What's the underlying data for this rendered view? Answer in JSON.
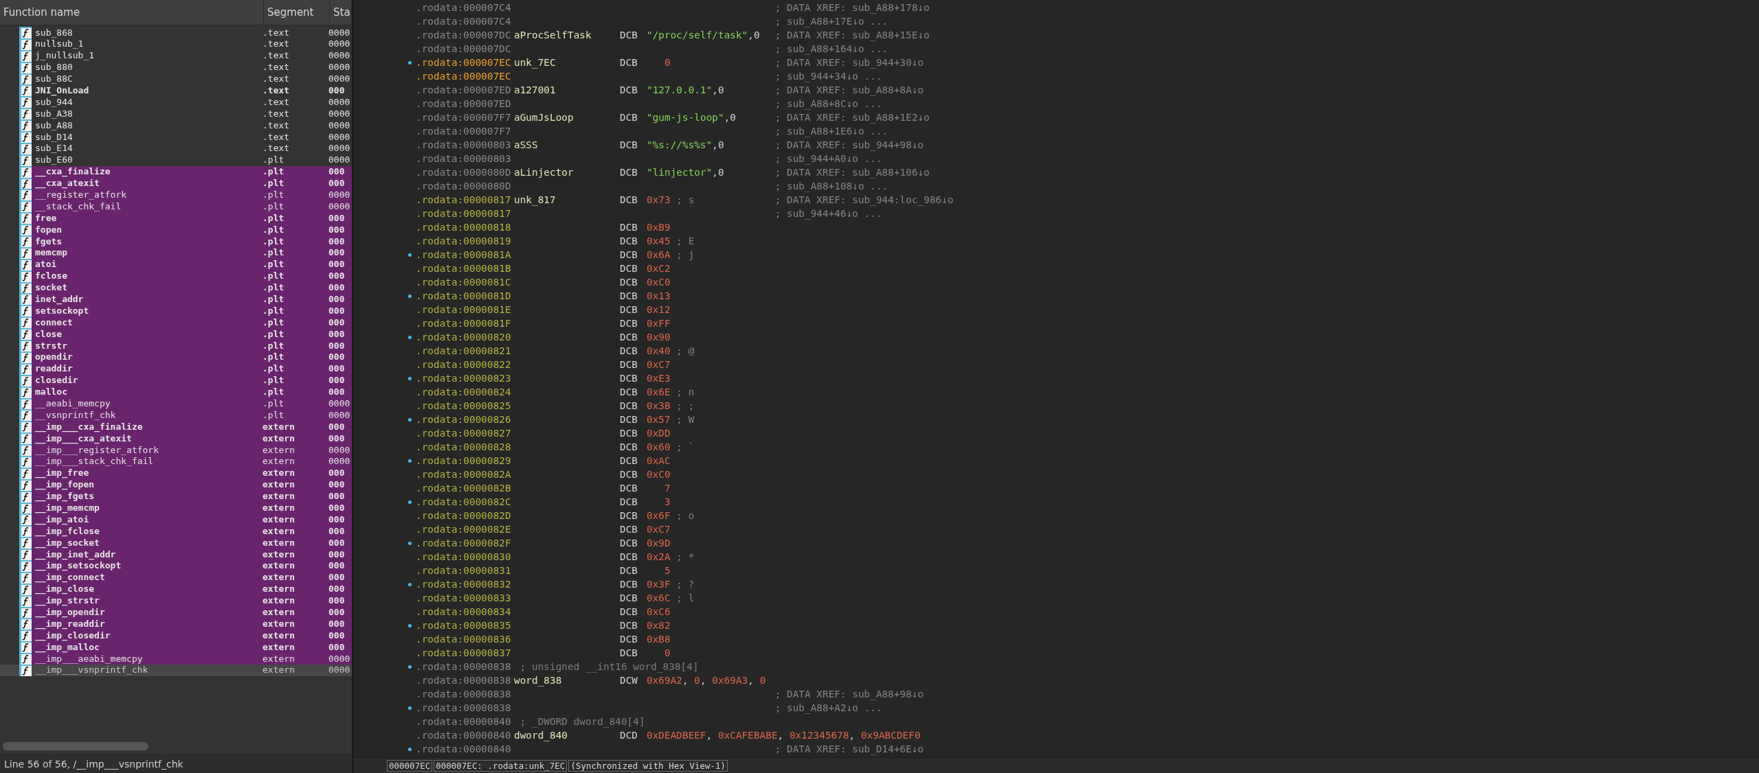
{
  "functions": {
    "columns": [
      "Function name",
      "Segment",
      "Sta"
    ],
    "rows": [
      {
        "name": "sub_868",
        "segment": ".text",
        "start": "0000",
        "bold": false,
        "library": false,
        "selected": false
      },
      {
        "name": "nullsub_1",
        "segment": ".text",
        "start": "0000",
        "bold": false,
        "library": false,
        "selected": false
      },
      {
        "name": "j_nullsub_1",
        "segment": ".text",
        "start": "0000",
        "bold": false,
        "library": false,
        "selected": false
      },
      {
        "name": "sub_880",
        "segment": ".text",
        "start": "0000",
        "bold": false,
        "library": false,
        "selected": false
      },
      {
        "name": "sub_88C",
        "segment": ".text",
        "start": "0000",
        "bold": false,
        "library": false,
        "selected": false
      },
      {
        "name": "JNI_OnLoad",
        "segment": ".text",
        "start": "000",
        "bold": true,
        "library": false,
        "selected": false
      },
      {
        "name": "sub_944",
        "segment": ".text",
        "start": "0000",
        "bold": false,
        "library": false,
        "selected": false
      },
      {
        "name": "sub_A38",
        "segment": ".text",
        "start": "0000",
        "bold": false,
        "library": false,
        "selected": false
      },
      {
        "name": "sub_A88",
        "segment": ".text",
        "start": "0000",
        "bold": false,
        "library": false,
        "selected": false
      },
      {
        "name": "sub_D14",
        "segment": ".text",
        "start": "0000",
        "bold": false,
        "library": false,
        "selected": false
      },
      {
        "name": "sub_E14",
        "segment": ".text",
        "start": "0000",
        "bold": false,
        "library": false,
        "selected": false
      },
      {
        "name": "sub_E60",
        "segment": ".plt",
        "start": "0000",
        "bold": false,
        "library": false,
        "selected": false
      },
      {
        "name": "__cxa_finalize",
        "segment": ".plt",
        "start": "000",
        "bold": true,
        "library": true,
        "selected": false
      },
      {
        "name": "__cxa_atexit",
        "segment": ".plt",
        "start": "000",
        "bold": true,
        "library": true,
        "selected": false
      },
      {
        "name": "__register_atfork",
        "segment": ".plt",
        "start": "0000",
        "bold": false,
        "library": true,
        "selected": false
      },
      {
        "name": "__stack_chk_fail",
        "segment": ".plt",
        "start": "0000",
        "bold": false,
        "library": true,
        "selected": false
      },
      {
        "name": "free",
        "segment": ".plt",
        "start": "000",
        "bold": true,
        "library": true,
        "selected": false
      },
      {
        "name": "fopen",
        "segment": ".plt",
        "start": "000",
        "bold": true,
        "library": true,
        "selected": false
      },
      {
        "name": "fgets",
        "segment": ".plt",
        "start": "000",
        "bold": true,
        "library": true,
        "selected": false
      },
      {
        "name": "memcmp",
        "segment": ".plt",
        "start": "000",
        "bold": true,
        "library": true,
        "selected": false
      },
      {
        "name": "atoi",
        "segment": ".plt",
        "start": "000",
        "bold": true,
        "library": true,
        "selected": false
      },
      {
        "name": "fclose",
        "segment": ".plt",
        "start": "000",
        "bold": true,
        "library": true,
        "selected": false
      },
      {
        "name": "socket",
        "segment": ".plt",
        "start": "000",
        "bold": true,
        "library": true,
        "selected": false
      },
      {
        "name": "inet_addr",
        "segment": ".plt",
        "start": "000",
        "bold": true,
        "library": true,
        "selected": false
      },
      {
        "name": "setsockopt",
        "segment": ".plt",
        "start": "000",
        "bold": true,
        "library": true,
        "selected": false
      },
      {
        "name": "connect",
        "segment": ".plt",
        "start": "000",
        "bold": true,
        "library": true,
        "selected": false
      },
      {
        "name": "close",
        "segment": ".plt",
        "start": "000",
        "bold": true,
        "library": true,
        "selected": false
      },
      {
        "name": "strstr",
        "segment": ".plt",
        "start": "000",
        "bold": true,
        "library": true,
        "selected": false
      },
      {
        "name": "opendir",
        "segment": ".plt",
        "start": "000",
        "bold": true,
        "library": true,
        "selected": false
      },
      {
        "name": "readdir",
        "segment": ".plt",
        "start": "000",
        "bold": true,
        "library": true,
        "selected": false
      },
      {
        "name": "closedir",
        "segment": ".plt",
        "start": "000",
        "bold": true,
        "library": true,
        "selected": false
      },
      {
        "name": "malloc",
        "segment": ".plt",
        "start": "000",
        "bold": true,
        "library": true,
        "selected": false
      },
      {
        "name": "__aeabi_memcpy",
        "segment": ".plt",
        "start": "0000",
        "bold": false,
        "library": true,
        "selected": false
      },
      {
        "name": "__vsnprintf_chk",
        "segment": ".plt",
        "start": "0000",
        "bold": false,
        "library": true,
        "selected": false
      },
      {
        "name": "__imp___cxa_finalize",
        "segment": "extern",
        "start": "000",
        "bold": true,
        "library": true,
        "selected": false
      },
      {
        "name": "__imp___cxa_atexit",
        "segment": "extern",
        "start": "000",
        "bold": true,
        "library": true,
        "selected": false
      },
      {
        "name": "__imp___register_atfork",
        "segment": "extern",
        "start": "0000",
        "bold": false,
        "library": true,
        "selected": false
      },
      {
        "name": "__imp___stack_chk_fail",
        "segment": "extern",
        "start": "0000",
        "bold": false,
        "library": true,
        "selected": false
      },
      {
        "name": "__imp_free",
        "segment": "extern",
        "start": "000",
        "bold": true,
        "library": true,
        "selected": false
      },
      {
        "name": "__imp_fopen",
        "segment": "extern",
        "start": "000",
        "bold": true,
        "library": true,
        "selected": false
      },
      {
        "name": "__imp_fgets",
        "segment": "extern",
        "start": "000",
        "bold": true,
        "library": true,
        "selected": false
      },
      {
        "name": "__imp_memcmp",
        "segment": "extern",
        "start": "000",
        "bold": true,
        "library": true,
        "selected": false
      },
      {
        "name": "__imp_atoi",
        "segment": "extern",
        "start": "000",
        "bold": true,
        "library": true,
        "selected": false
      },
      {
        "name": "__imp_fclose",
        "segment": "extern",
        "start": "000",
        "bold": true,
        "library": true,
        "selected": false
      },
      {
        "name": "__imp_socket",
        "segment": "extern",
        "start": "000",
        "bold": true,
        "library": true,
        "selected": false
      },
      {
        "name": "__imp_inet_addr",
        "segment": "extern",
        "start": "000",
        "bold": true,
        "library": true,
        "selected": false
      },
      {
        "name": "__imp_setsockopt",
        "segment": "extern",
        "start": "000",
        "bold": true,
        "library": true,
        "selected": false
      },
      {
        "name": "__imp_connect",
        "segment": "extern",
        "start": "000",
        "bold": true,
        "library": true,
        "selected": false
      },
      {
        "name": "__imp_close",
        "segment": "extern",
        "start": "000",
        "bold": true,
        "library": true,
        "selected": false
      },
      {
        "name": "__imp_strstr",
        "segment": "extern",
        "start": "000",
        "bold": true,
        "library": true,
        "selected": false
      },
      {
        "name": "__imp_opendir",
        "segment": "extern",
        "start": "000",
        "bold": true,
        "library": true,
        "selected": false
      },
      {
        "name": "__imp_readdir",
        "segment": "extern",
        "start": "000",
        "bold": true,
        "library": true,
        "selected": false
      },
      {
        "name": "__imp_closedir",
        "segment": "extern",
        "start": "000",
        "bold": true,
        "library": true,
        "selected": false
      },
      {
        "name": "__imp_malloc",
        "segment": "extern",
        "start": "000",
        "bold": true,
        "library": true,
        "selected": false
      },
      {
        "name": "__imp___aeabi_memcpy",
        "segment": "extern",
        "start": "0000",
        "bold": false,
        "library": true,
        "selected": false
      },
      {
        "name": "__imp___vsnprintf_chk",
        "segment": "extern",
        "start": "0000",
        "bold": false,
        "library": false,
        "selected": true
      }
    ],
    "status": "Line 56 of 56, /__imp___vsnprintf_chk"
  },
  "listing": {
    "lines": [
      {
        "address": ".rodata:000007C4",
        "kind": "plain",
        "dot": false,
        "xref": "; DATA XREF: sub_A88+178↓o"
      },
      {
        "address": ".rodata:000007C4",
        "kind": "plain",
        "dot": false,
        "xref": "; sub_A88+17E↓o ..."
      },
      {
        "address": ".rodata:000007DC",
        "kind": "plain",
        "dot": false,
        "label": "aProcSelfTask",
        "mnemonic": "DCB",
        "args": [
          {
            "text": "\"/proc/self/task\"",
            "kind": "str"
          },
          {
            "text": ",0",
            "kind": "sep"
          }
        ],
        "xref": "; DATA XREF: sub_A88+15E↓o"
      },
      {
        "address": ".rodata:000007DC",
        "kind": "plain",
        "dot": false,
        "xref": "; sub_A88+164↓o ..."
      },
      {
        "address": ".rodata:000007EC",
        "kind": "current",
        "dot": true,
        "label": "unk_7EC",
        "mnemonic": "DCB",
        "args": [
          {
            "text": "0",
            "kind": "dec"
          }
        ],
        "xref": "; DATA XREF: sub_944+30↓o"
      },
      {
        "address": ".rodata:000007EC",
        "kind": "current",
        "dot": false,
        "xref": "; sub_944+34↓o ..."
      },
      {
        "address": ".rodata:000007ED",
        "kind": "plain",
        "dot": false,
        "label": "a127001",
        "mnemonic": "DCB",
        "args": [
          {
            "text": "\"127.0.0.1\"",
            "kind": "str"
          },
          {
            "text": ",0",
            "kind": "sep"
          }
        ],
        "xref": "; DATA XREF: sub_A88+8A↓o"
      },
      {
        "address": ".rodata:000007ED",
        "kind": "plain",
        "dot": false,
        "xref": "; sub_A88+8C↓o ..."
      },
      {
        "address": ".rodata:000007F7",
        "kind": "plain",
        "dot": false,
        "label": "aGumJsLoop",
        "mnemonic": "DCB",
        "args": [
          {
            "text": "\"gum-js-loop\"",
            "kind": "str"
          },
          {
            "text": ",0",
            "kind": "sep"
          }
        ],
        "xref": "; DATA XREF: sub_A88+1E2↓o"
      },
      {
        "address": ".rodata:000007F7",
        "kind": "plain",
        "dot": false,
        "xref": "; sub_A88+1E6↓o ..."
      },
      {
        "address": ".rodata:00000803",
        "kind": "plain",
        "dot": false,
        "label": "aSSS",
        "mnemonic": "DCB",
        "args": [
          {
            "text": "\"%s://%s%s\"",
            "kind": "str"
          },
          {
            "text": ",0",
            "kind": "sep"
          }
        ],
        "xref": "; DATA XREF: sub_944+98↓o"
      },
      {
        "address": ".rodata:00000803",
        "kind": "plain",
        "dot": false,
        "xref": "; sub_944+A0↓o ..."
      },
      {
        "address": ".rodata:0000080D",
        "kind": "plain",
        "dot": false,
        "label": "aLinjector",
        "mnemonic": "DCB",
        "args": [
          {
            "text": "\"linjector\"",
            "kind": "str"
          },
          {
            "text": ",0",
            "kind": "sep"
          }
        ],
        "xref": "; DATA XREF: sub_A88+106↓o"
      },
      {
        "address": ".rodata:0000080D",
        "kind": "plain",
        "dot": false,
        "xref": "; sub_A88+108↓o ..."
      },
      {
        "address": ".rodata:00000817",
        "kind": "data",
        "dot": false,
        "label": "unk_817",
        "mnemonic": "DCB",
        "args": [
          {
            "text": "0x73",
            "kind": "num"
          }
        ],
        "note": "; s",
        "xref": "; DATA XREF: sub_944:loc_986↓o"
      },
      {
        "address": ".rodata:00000817",
        "kind": "data",
        "dot": false,
        "xref": "; sub_944+46↓o ..."
      },
      {
        "address": ".rodata:00000818",
        "kind": "data",
        "dot": false,
        "mnemonic": "DCB",
        "args": [
          {
            "text": "0xB9",
            "kind": "num"
          }
        ]
      },
      {
        "address": ".rodata:00000819",
        "kind": "data",
        "dot": false,
        "mnemonic": "DCB",
        "args": [
          {
            "text": "0x45",
            "kind": "num"
          }
        ],
        "note": "; E"
      },
      {
        "address": ".rodata:0000081A",
        "kind": "data",
        "dot": true,
        "mnemonic": "DCB",
        "args": [
          {
            "text": "0x6A",
            "kind": "num"
          }
        ],
        "note": "; j"
      },
      {
        "address": ".rodata:0000081B",
        "kind": "data",
        "dot": false,
        "mnemonic": "DCB",
        "args": [
          {
            "text": "0xC2",
            "kind": "num"
          }
        ]
      },
      {
        "address": ".rodata:0000081C",
        "kind": "data",
        "dot": false,
        "mnemonic": "DCB",
        "args": [
          {
            "text": "0xC0",
            "kind": "num"
          }
        ]
      },
      {
        "address": ".rodata:0000081D",
        "kind": "data",
        "dot": true,
        "mnemonic": "DCB",
        "args": [
          {
            "text": "0x13",
            "kind": "num"
          }
        ]
      },
      {
        "address": ".rodata:0000081E",
        "kind": "data",
        "dot": false,
        "mnemonic": "DCB",
        "args": [
          {
            "text": "0x12",
            "kind": "num"
          }
        ]
      },
      {
        "address": ".rodata:0000081F",
        "kind": "data",
        "dot": false,
        "mnemonic": "DCB",
        "args": [
          {
            "text": "0xFF",
            "kind": "num"
          }
        ]
      },
      {
        "address": ".rodata:00000820",
        "kind": "data",
        "dot": true,
        "mnemonic": "DCB",
        "args": [
          {
            "text": "0x90",
            "kind": "num"
          }
        ]
      },
      {
        "address": ".rodata:00000821",
        "kind": "data",
        "dot": false,
        "mnemonic": "DCB",
        "args": [
          {
            "text": "0x40",
            "kind": "num"
          }
        ],
        "note": "; @"
      },
      {
        "address": ".rodata:00000822",
        "kind": "data",
        "dot": false,
        "mnemonic": "DCB",
        "args": [
          {
            "text": "0xC7",
            "kind": "num"
          }
        ]
      },
      {
        "address": ".rodata:00000823",
        "kind": "data",
        "dot": true,
        "mnemonic": "DCB",
        "args": [
          {
            "text": "0xE3",
            "kind": "num"
          }
        ]
      },
      {
        "address": ".rodata:00000824",
        "kind": "data",
        "dot": false,
        "mnemonic": "DCB",
        "args": [
          {
            "text": "0x6E",
            "kind": "num"
          }
        ],
        "note": "; n"
      },
      {
        "address": ".rodata:00000825",
        "kind": "data",
        "dot": false,
        "mnemonic": "DCB",
        "args": [
          {
            "text": "0x3B",
            "kind": "num"
          }
        ],
        "note": "; ;"
      },
      {
        "address": ".rodata:00000826",
        "kind": "data",
        "dot": true,
        "mnemonic": "DCB",
        "args": [
          {
            "text": "0x57",
            "kind": "num"
          }
        ],
        "note": "; W"
      },
      {
        "address": ".rodata:00000827",
        "kind": "data",
        "dot": false,
        "mnemonic": "DCB",
        "args": [
          {
            "text": "0xDD",
            "kind": "num"
          }
        ]
      },
      {
        "address": ".rodata:00000828",
        "kind": "data",
        "dot": false,
        "mnemonic": "DCB",
        "args": [
          {
            "text": "0x60",
            "kind": "num"
          }
        ],
        "note": "; `"
      },
      {
        "address": ".rodata:00000829",
        "kind": "data",
        "dot": true,
        "mnemonic": "DCB",
        "args": [
          {
            "text": "0xAC",
            "kind": "num"
          }
        ]
      },
      {
        "address": ".rodata:0000082A",
        "kind": "data",
        "dot": false,
        "mnemonic": "DCB",
        "args": [
          {
            "text": "0xC0",
            "kind": "num"
          }
        ]
      },
      {
        "address": ".rodata:0000082B",
        "kind": "data",
        "dot": false,
        "mnemonic": "DCB",
        "args": [
          {
            "text": "7",
            "kind": "dec"
          }
        ]
      },
      {
        "address": ".rodata:0000082C",
        "kind": "data",
        "dot": true,
        "mnemonic": "DCB",
        "args": [
          {
            "text": "3",
            "kind": "dec"
          }
        ]
      },
      {
        "address": ".rodata:0000082D",
        "kind": "data",
        "dot": false,
        "mnemonic": "DCB",
        "args": [
          {
            "text": "0x6F",
            "kind": "num"
          }
        ],
        "note": "; o"
      },
      {
        "address": ".rodata:0000082E",
        "kind": "data",
        "dot": false,
        "mnemonic": "DCB",
        "args": [
          {
            "text": "0xC7",
            "kind": "num"
          }
        ]
      },
      {
        "address": ".rodata:0000082F",
        "kind": "data",
        "dot": true,
        "mnemonic": "DCB",
        "args": [
          {
            "text": "0x9D",
            "kind": "num"
          }
        ]
      },
      {
        "address": ".rodata:00000830",
        "kind": "data",
        "dot": false,
        "mnemonic": "DCB",
        "args": [
          {
            "text": "0x2A",
            "kind": "num"
          }
        ],
        "note": "; *"
      },
      {
        "address": ".rodata:00000831",
        "kind": "data",
        "dot": false,
        "mnemonic": "DCB",
        "args": [
          {
            "text": "5",
            "kind": "dec"
          }
        ]
      },
      {
        "address": ".rodata:00000832",
        "kind": "data",
        "dot": true,
        "mnemonic": "DCB",
        "args": [
          {
            "text": "0x3F",
            "kind": "num"
          }
        ],
        "note": "; ?"
      },
      {
        "address": ".rodata:00000833",
        "kind": "data",
        "dot": false,
        "mnemonic": "DCB",
        "args": [
          {
            "text": "0x6C",
            "kind": "num"
          }
        ],
        "note": "; l"
      },
      {
        "address": ".rodata:00000834",
        "kind": "data",
        "dot": false,
        "mnemonic": "DCB",
        "args": [
          {
            "text": "0xC6",
            "kind": "num"
          }
        ]
      },
      {
        "address": ".rodata:00000835",
        "kind": "data",
        "dot": true,
        "mnemonic": "DCB",
        "args": [
          {
            "text": "0x82",
            "kind": "num"
          }
        ]
      },
      {
        "address": ".rodata:00000836",
        "kind": "data",
        "dot": false,
        "mnemonic": "DCB",
        "args": [
          {
            "text": "0xB8",
            "kind": "num"
          }
        ]
      },
      {
        "address": ".rodata:00000837",
        "kind": "data",
        "dot": false,
        "mnemonic": "DCB",
        "args": [
          {
            "text": "0",
            "kind": "dec"
          }
        ]
      },
      {
        "address": ".rodata:00000838",
        "kind": "plain",
        "dot": true,
        "comment": "; unsigned __int16 word_838[4]"
      },
      {
        "address": ".rodata:00000838",
        "kind": "plain",
        "dot": false,
        "label": "word_838",
        "mnemonic": "DCW",
        "args": [
          {
            "text": "0x69A2",
            "kind": "num"
          },
          {
            "text": ", ",
            "kind": "sep"
          },
          {
            "text": "0",
            "kind": "num"
          },
          {
            "text": ", ",
            "kind": "sep"
          },
          {
            "text": "0x69A3",
            "kind": "num"
          },
          {
            "text": ", ",
            "kind": "sep"
          },
          {
            "text": "0",
            "kind": "num"
          }
        ]
      },
      {
        "address": ".rodata:00000838",
        "kind": "plain",
        "dot": false,
        "xref": "; DATA XREF: sub_A88+98↓o"
      },
      {
        "address": ".rodata:00000838",
        "kind": "plain",
        "dot": true,
        "xref": "; sub_A88+A2↓o ..."
      },
      {
        "address": ".rodata:00000840",
        "kind": "plain",
        "dot": false,
        "comment": "; _DWORD dword_840[4]"
      },
      {
        "address": ".rodata:00000840",
        "kind": "plain",
        "dot": false,
        "label": "dword_840",
        "mnemonic": "DCD",
        "args": [
          {
            "text": "0xDEADBEEF",
            "kind": "num"
          },
          {
            "text": ", ",
            "kind": "sep"
          },
          {
            "text": "0xCAFEBABE",
            "kind": "num"
          },
          {
            "text": ", ",
            "kind": "sep"
          },
          {
            "text": "0x12345678",
            "kind": "num"
          },
          {
            "text": ", ",
            "kind": "sep"
          },
          {
            "text": "0x9ABCDEF0",
            "kind": "num"
          }
        ]
      },
      {
        "address": ".rodata:00000840",
        "kind": "plain",
        "dot": true,
        "xref": "; DATA XREF: sub_D14+6E↓o"
      }
    ],
    "status": [
      "000007EC",
      "000007EC: .rodata:unk_7EC",
      "(Synchronized with Hex View-1)"
    ]
  }
}
